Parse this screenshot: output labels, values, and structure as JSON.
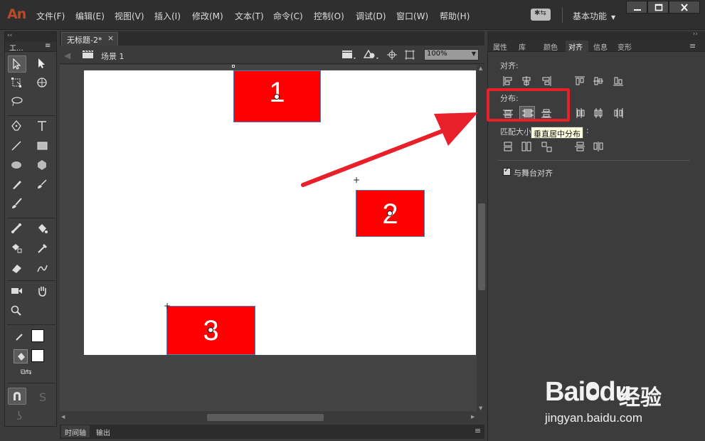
{
  "app": {
    "logo": "An"
  },
  "menu": [
    "文件(F)",
    "编辑(E)",
    "视图(V)",
    "插入(I)",
    "修改(M)",
    "文本(T)",
    "命令(C)",
    "控制(O)",
    "调试(D)",
    "窗口(W)",
    "帮助(H)"
  ],
  "workspace": {
    "label": "基本功能"
  },
  "tools_panel": {
    "title": "工..."
  },
  "document": {
    "tab_title": "无标题-2*",
    "tab_close": "×",
    "scene": "场景 1",
    "zoom": "100%"
  },
  "stage_objects": [
    {
      "label": "1",
      "color": "#ff0000"
    },
    {
      "label": "2",
      "color": "#ff0000"
    },
    {
      "label": "3",
      "color": "#ff0000"
    }
  ],
  "bottom_tabs": [
    "时间轴",
    "输出"
  ],
  "right_panel": {
    "tabs": [
      "属性",
      "库",
      "颜色",
      "对齐",
      "信息",
      "变形"
    ],
    "active_tab": "对齐",
    "align_label": "对齐:",
    "distribute_label": "分布:",
    "match_size_label": "匹配大小",
    "spacing_label_tail": ":",
    "tooltip": "垂直居中分布",
    "stage_align_label": "与舞台对齐",
    "stage_align_checked": true,
    "check_mark": "✓"
  },
  "annotation": {
    "highlight_color": "#e8202a"
  },
  "watermark": {
    "brand": "Bai",
    "brand2": "du",
    "cn": "经验",
    "url": "jingyan.baidu.com"
  }
}
